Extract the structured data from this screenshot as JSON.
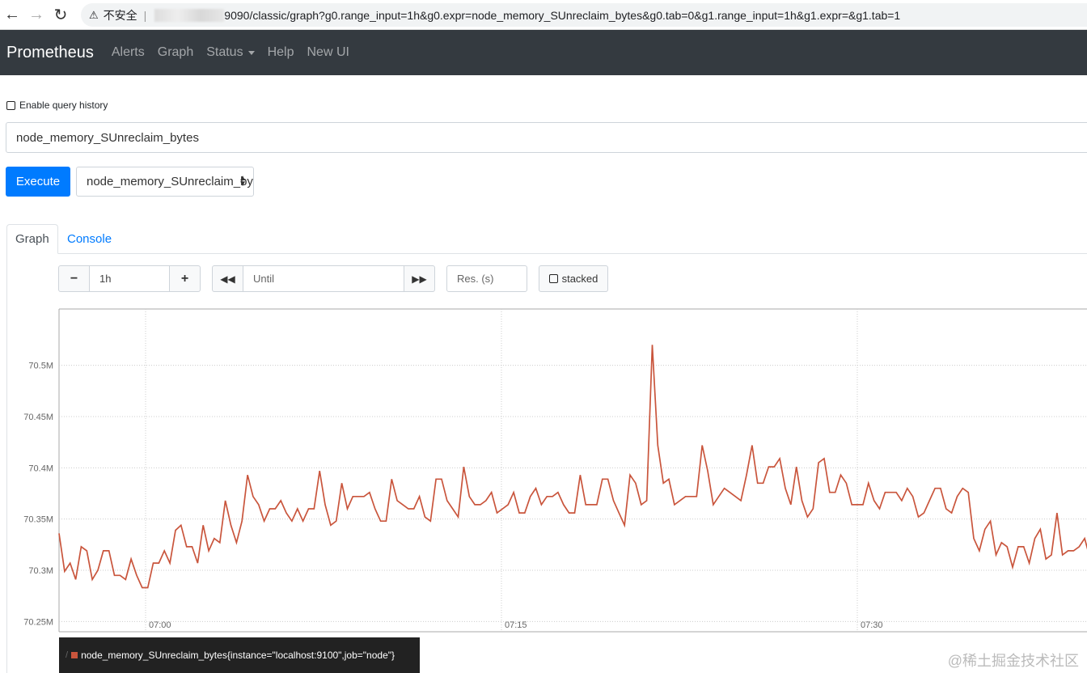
{
  "browser": {
    "insecure_label": "不安全",
    "url_suffix": "9090/classic/graph?g0.range_input=1h&g0.expr=node_memory_SUnreclaim_bytes&g0.tab=0&g1.range_input=1h&g1.expr=&g1.tab=1"
  },
  "navbar": {
    "brand": "Prometheus",
    "links": [
      "Alerts",
      "Graph",
      "Status",
      "Help",
      "New UI"
    ]
  },
  "query": {
    "history_label": "Enable query history",
    "expression": "node_memory_SUnreclaim_bytes",
    "execute_label": "Execute",
    "metric_selected": "node_memory_SUnreclaim_bytes"
  },
  "tabs": {
    "graph": "Graph",
    "console": "Console"
  },
  "controls": {
    "range": "1h",
    "until_placeholder": "Until",
    "res_placeholder": "Res. (s)",
    "stacked_label": "stacked"
  },
  "legend": {
    "series": "node_memory_SUnreclaim_bytes{instance=\"localhost:9100\",job=\"node\"}",
    "color": "#c9553c"
  },
  "watermark": "@稀土掘金技术社区",
  "chart_data": {
    "type": "line",
    "ylim": [
      70.24,
      70.555
    ],
    "y_ticks": [
      "70.25M",
      "70.3M",
      "70.35M",
      "70.4M",
      "70.45M",
      "70.5M"
    ],
    "y_tick_values": [
      70.25,
      70.3,
      70.35,
      70.4,
      70.45,
      70.5
    ],
    "x_ticks": [
      "07:00",
      "07:15",
      "07:30"
    ],
    "grid": true,
    "series": [
      {
        "values": [
          70.336,
          70.299,
          70.307,
          70.291,
          70.323,
          70.319,
          70.291,
          70.3,
          70.319,
          70.319,
          70.295,
          70.295,
          70.291,
          70.311,
          70.295,
          70.283,
          70.283,
          70.307,
          70.307,
          70.319,
          70.307,
          70.339,
          70.344,
          70.323,
          70.323,
          70.307,
          70.344,
          70.319,
          70.331,
          70.327,
          70.368,
          70.344,
          70.327,
          70.348,
          70.393,
          70.372,
          70.364,
          70.348,
          70.36,
          70.36,
          70.368,
          70.356,
          70.348,
          70.36,
          70.348,
          70.36,
          70.36,
          70.397,
          70.364,
          70.344,
          70.348,
          70.385,
          70.36,
          70.372,
          70.372,
          70.372,
          70.376,
          70.36,
          70.348,
          70.348,
          70.389,
          70.368,
          70.364,
          70.36,
          70.36,
          70.372,
          70.352,
          70.348,
          70.389,
          70.389,
          70.368,
          70.36,
          70.352,
          70.401,
          70.372,
          70.364,
          70.364,
          70.368,
          70.376,
          70.356,
          70.36,
          70.364,
          70.376,
          70.356,
          70.356,
          70.372,
          70.38,
          70.364,
          70.372,
          70.372,
          70.376,
          70.364,
          70.356,
          70.356,
          70.393,
          70.364,
          70.364,
          70.364,
          70.389,
          70.389,
          70.368,
          70.356,
          70.344,
          70.393,
          70.385,
          70.364,
          70.368,
          70.52,
          70.422,
          70.385,
          70.389,
          70.364,
          70.368,
          70.372,
          70.372,
          70.372,
          70.422,
          70.397,
          70.364,
          70.372,
          70.38,
          70.376,
          70.372,
          70.368,
          70.393,
          70.422,
          70.385,
          70.385,
          70.401,
          70.401,
          70.409,
          70.38,
          70.364,
          70.401,
          70.368,
          70.352,
          70.36,
          70.405,
          70.409,
          70.376,
          70.376,
          70.393,
          70.385,
          70.364,
          70.364,
          70.364,
          70.385,
          70.368,
          70.36,
          70.376,
          70.376,
          70.376,
          70.368,
          70.38,
          70.372,
          70.352,
          70.356,
          70.368,
          70.38,
          70.38,
          70.36,
          70.356,
          70.372,
          70.38,
          70.376,
          70.331,
          70.319,
          70.34,
          70.348,
          70.315,
          70.327,
          70.323,
          70.303,
          70.323,
          70.323,
          70.307,
          70.331,
          70.34,
          70.311,
          70.315,
          70.356,
          70.315,
          70.319,
          70.319,
          70.323,
          70.331,
          70.311
        ]
      }
    ]
  }
}
